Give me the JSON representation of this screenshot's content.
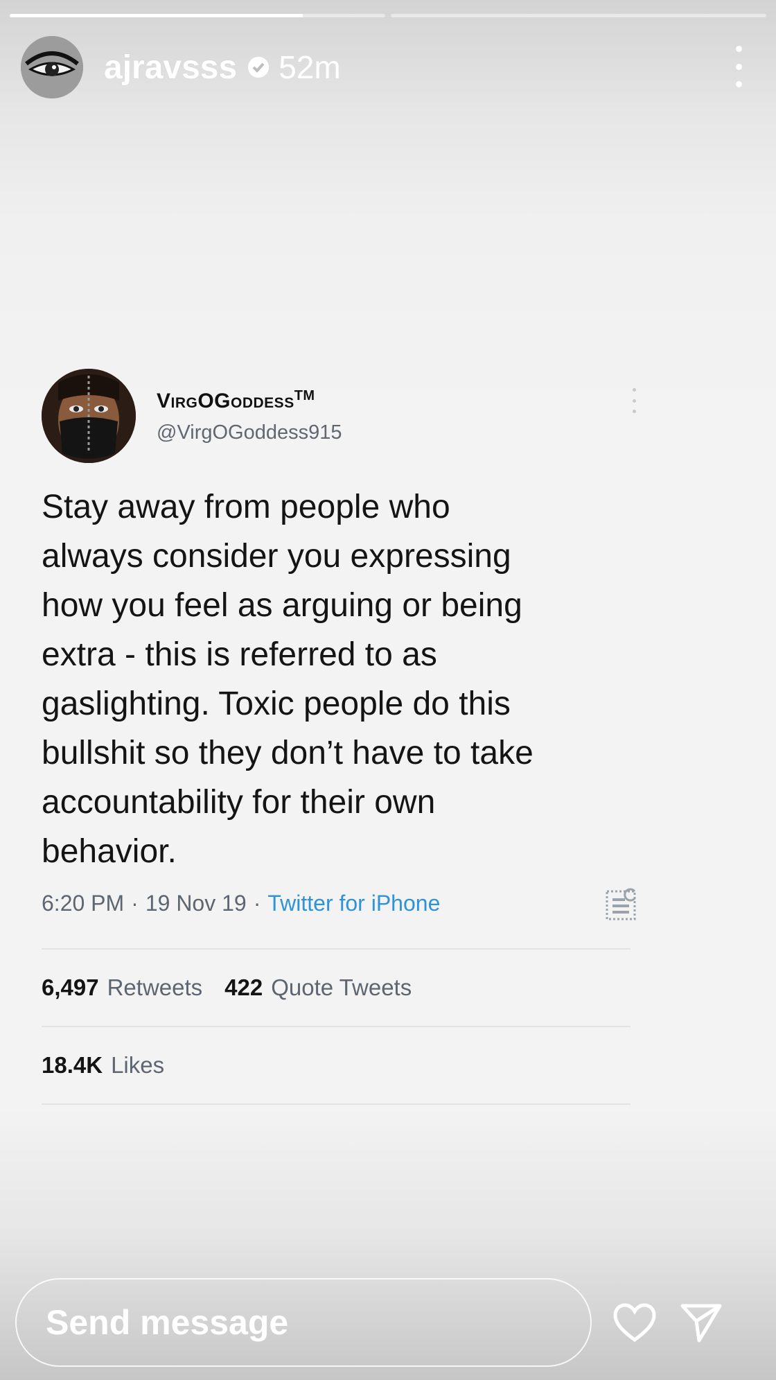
{
  "story": {
    "username": "ajravsss",
    "time": "52m",
    "progress": [
      0.78,
      0.0
    ]
  },
  "tweet": {
    "display_name": "VirgOGoddess",
    "display_name_suffix": "TM",
    "handle": "@VirgOGoddess915",
    "text_lines": [
      "Stay away from people who",
      "always consider you expressing",
      "how you feel as arguing or being",
      "extra - this is referred to as",
      "gaslighting. Toxic people do this",
      "bullshit so they don’t have to take",
      "accountability for their own",
      "behavior."
    ],
    "time": "6:20 PM",
    "date": "19 Nov 19",
    "source": "Twitter for iPhone",
    "retweets_count": "6,497",
    "retweets_label": "Retweets",
    "quotes_count": "422",
    "quotes_label": "Quote Tweets",
    "likes_count": "18.4K",
    "likes_label": "Likes"
  },
  "composer": {
    "placeholder": "Send message"
  },
  "icons": {
    "verified": "verified-badge-icon",
    "more": "more-vertical-icon",
    "analytics": "analytics-icon",
    "like": "heart-icon",
    "share": "send-icon"
  },
  "colors": {
    "link": "#2f93d8",
    "secondary_text": "#5d6670"
  }
}
